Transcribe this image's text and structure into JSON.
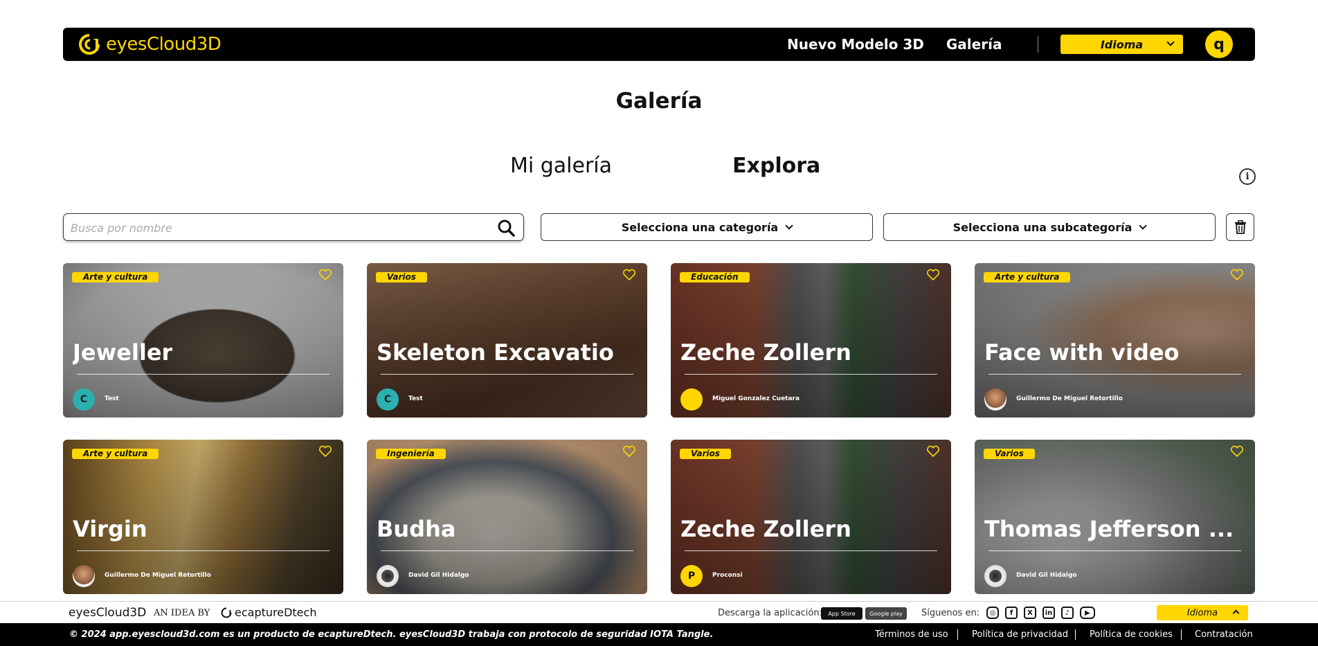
{
  "app": {
    "name": "eyesCloud3D"
  },
  "nav": {
    "new_model": "Nuevo Modelo 3D",
    "gallery": "Galería",
    "language": "Idioma",
    "user_initial": "q"
  },
  "page": {
    "title": "Galería"
  },
  "tabs": [
    {
      "label": "Mi galería",
      "active": false
    },
    {
      "label": "Explora",
      "active": true
    }
  ],
  "filters": {
    "search_placeholder": "Busca por nombre",
    "category": "Selecciona una categoría",
    "subcategory": "Selecciona una subcategoría"
  },
  "cards": [
    {
      "category": "Arte y cultura",
      "title": "Jeweller",
      "author": "Test",
      "avatar": "ec"
    },
    {
      "category": "Varios",
      "title": "Skeleton Excavatio",
      "author": "Test",
      "avatar": "ec"
    },
    {
      "category": "Educación",
      "title": "Zeche Zollern",
      "author": "Miguel Gonzalez Cuetara",
      "avatar": "yellow"
    },
    {
      "category": "Arte y cultura",
      "title": "Face with video",
      "author": "Guillermo De Miguel Retortillo",
      "avatar": "photo"
    },
    {
      "category": "Arte y cultura",
      "title": "Virgin",
      "author": "Guillermo De Miguel Retortillo",
      "avatar": "photo"
    },
    {
      "category": "Ingeniería",
      "title": "Budha",
      "author": "David Gil Hidalgo",
      "avatar": "photo2"
    },
    {
      "category": "Varios",
      "title": "Zeche Zollern",
      "author": "Proconsi",
      "avatar": "P"
    },
    {
      "category": "Varios",
      "title": "Thomas Jefferson ...",
      "author": "David Gil Hidalgo",
      "avatar": "photo2"
    }
  ],
  "footer": {
    "brand": "eyesCloud3D",
    "idea_by": "AN IDEA BY",
    "ecapture": "ecaptureDtech",
    "download": "Descarga la aplicación:",
    "app_store": "App Store",
    "google_play": "Google play",
    "follow": "Síguenos en:",
    "language": "Idioma",
    "copyright": "© 2024 app.eyescloud3d.com es un producto de ecaptureDtech. eyesCloud3D trabaja con protocolo de seguridad IOTA Tangle.",
    "links": [
      "Términos de uso",
      "Política de privacidad",
      "Política de cookies",
      "Contratación"
    ]
  },
  "colors": {
    "accent": "#FFD600",
    "dark": "#000000"
  }
}
